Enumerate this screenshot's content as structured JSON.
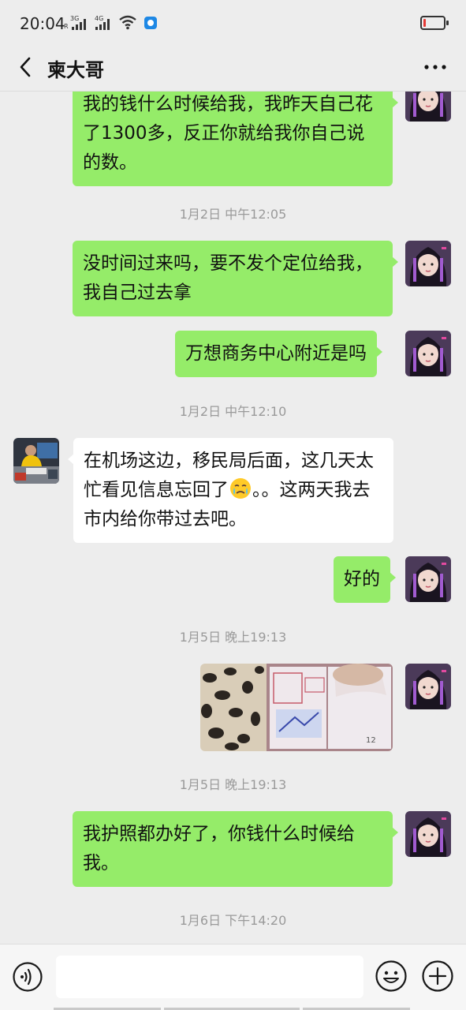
{
  "status_bar": {
    "time": "20:04",
    "sim1_label": "3G",
    "sim1_sub": "R",
    "sim2_label": "4G",
    "battery_level": 0.1,
    "battery_color": "#e53935"
  },
  "header": {
    "title": "柬大哥",
    "back_icon": "chevron-left-icon",
    "more_icon": "more-horizontal-icon"
  },
  "colors": {
    "my_bubble": "#95ec69",
    "their_bubble": "#ffffff",
    "background": "#ededed"
  },
  "messages": [
    {
      "sender": "me",
      "text": "我的钱什么时候给我，我昨天自己花了1300多，反正你就给我你自己说的数。"
    },
    {
      "type": "timestamp",
      "text": "1月2日 中午12:05"
    },
    {
      "sender": "me",
      "text": "没时间过来吗，要不发个定位给我，我自己过去拿"
    },
    {
      "sender": "me",
      "text": "万想商务中心附近是吗"
    },
    {
      "type": "timestamp",
      "text": "1月2日 中午12:10"
    },
    {
      "sender": "other",
      "text_part1": "在机场这边，移民局后面，这几天太忙看见信息忘回了",
      "emoji": "crying-face-emoji",
      "text_part2": "。。这两天我去市内给你带过去吧。"
    },
    {
      "sender": "me",
      "text": "好的"
    },
    {
      "type": "timestamp",
      "text": "1月5日 晚上19:13"
    },
    {
      "sender": "me",
      "type": "image",
      "content": "passport-photo"
    },
    {
      "type": "timestamp",
      "text": "1月5日 晚上19:13"
    },
    {
      "sender": "me",
      "text": "我护照都办好了，你钱什么时候给我。"
    },
    {
      "type": "timestamp",
      "text": "1月6日 下午14:20"
    }
  ],
  "input_bar": {
    "voice_icon": "voice-icon",
    "emoji_icon": "emoji-icon",
    "plus_icon": "plus-icon",
    "text_value": ""
  }
}
